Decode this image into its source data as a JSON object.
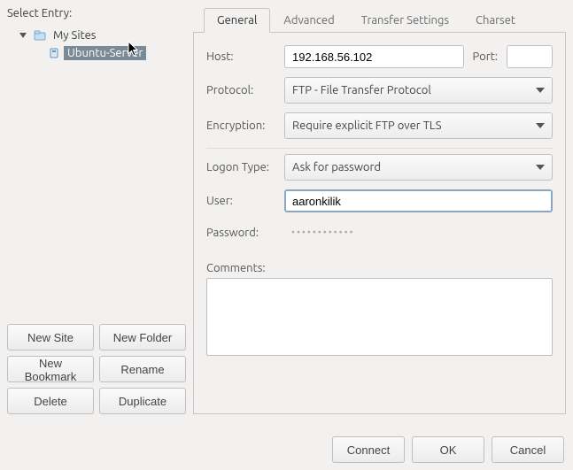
{
  "left": {
    "select_label": "Select Entry:",
    "root_label": "My Sites",
    "child_label": "Ubuntu-Server",
    "buttons": {
      "new_site": "New Site",
      "new_folder": "New Folder",
      "new_bookmark": "New Bookmark",
      "rename": "Rename",
      "delete": "Delete",
      "duplicate": "Duplicate"
    }
  },
  "tabs": {
    "general": "General",
    "advanced": "Advanced",
    "transfer": "Transfer Settings",
    "charset": "Charset"
  },
  "form": {
    "host_label": "Host:",
    "host_value": "192.168.56.102",
    "port_label": "Port:",
    "port_value": "",
    "protocol_label": "Protocol:",
    "protocol_value": "FTP - File Transfer Protocol",
    "encryption_label": "Encryption:",
    "encryption_value": "Require explicit FTP over TLS",
    "logon_label": "Logon Type:",
    "logon_value": "Ask for password",
    "user_label": "User:",
    "user_value": "aaronkilik",
    "password_label": "Password:",
    "password_mask": "••••••••••••",
    "comments_label": "Comments:",
    "comments_value": ""
  },
  "bottom": {
    "connect": "Connect",
    "ok": "OK",
    "cancel": "Cancel"
  }
}
